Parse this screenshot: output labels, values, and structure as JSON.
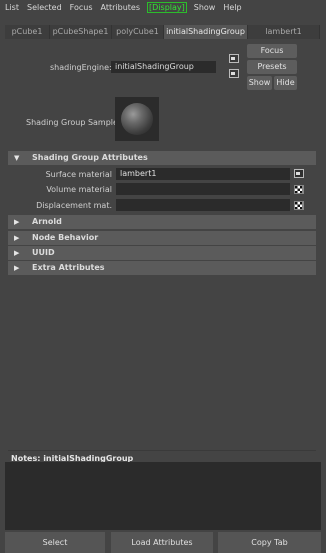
{
  "menu": [
    "List",
    "Selected",
    "Focus",
    "Attributes",
    "[Display]",
    "Show",
    "Help"
  ],
  "tabs": [
    "pCube1",
    "pCubeShape1",
    "polyCube1",
    "initialShadingGroup",
    "lambert1"
  ],
  "selected_tab_index": 3,
  "header": {
    "shading_engine_label": "shadingEngine:",
    "shading_engine_value": "initialShadingGroup",
    "focus_label": "Focus",
    "presets_label": "Presets",
    "show_label": "Show",
    "hide_label": "Hide",
    "sample_label": "Shading Group Sample"
  },
  "sections": {
    "shading_group_attributes": "Shading Group Attributes",
    "arnold": "Arnold",
    "node_behavior": "Node Behavior",
    "uuid": "UUID",
    "extra_attributes": "Extra Attributes"
  },
  "attributes": [
    {
      "label": "Surface material",
      "value": "lambert1"
    },
    {
      "label": "Volume material",
      "value": ""
    },
    {
      "label": "Displacement mat.",
      "value": ""
    }
  ],
  "notes": {
    "label": "Notes:  initialShadingGroup",
    "text": ""
  },
  "bottom_buttons": [
    "Select",
    "Load Attributes",
    "Copy Tab"
  ],
  "colors": {
    "background": "#444444",
    "field": "#2b2b2b",
    "section": "#5b5b5b",
    "active_menu": "#35e235"
  }
}
